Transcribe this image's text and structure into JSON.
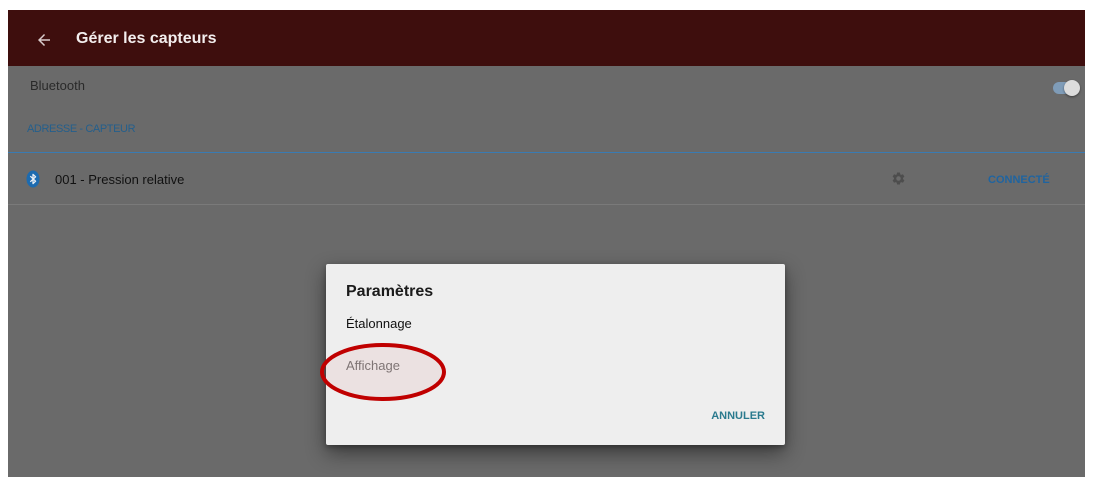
{
  "app_bar": {
    "title": "Gérer les capteurs",
    "back_icon": "arrow-back-icon"
  },
  "bluetooth": {
    "label": "Bluetooth",
    "enabled": true
  },
  "sensor_list": {
    "header": "ADRESSE - CAPTEUR",
    "sensors": [
      {
        "name": "001 - Pression relative",
        "status": "CONNECTÉ",
        "icon": "bluetooth-icon",
        "settings_icon": "gear-icon"
      }
    ]
  },
  "dialog": {
    "title": "Paramètres",
    "items": [
      {
        "label": "Étalonnage",
        "enabled": true
      },
      {
        "label": "Affichage",
        "enabled": false
      }
    ],
    "cancel_label": "ANNULER"
  },
  "colors": {
    "app_bar": "#3e0e0d",
    "accent_blue": "#1f64a0",
    "section_blue": "#245f8c",
    "divider_blue": "#3a7bb2",
    "dialog_action": "#2a7a8e",
    "scrim_background": "#6a6a6a",
    "dialog_background": "#eeeeee",
    "annotation_circle": "#c00000"
  }
}
